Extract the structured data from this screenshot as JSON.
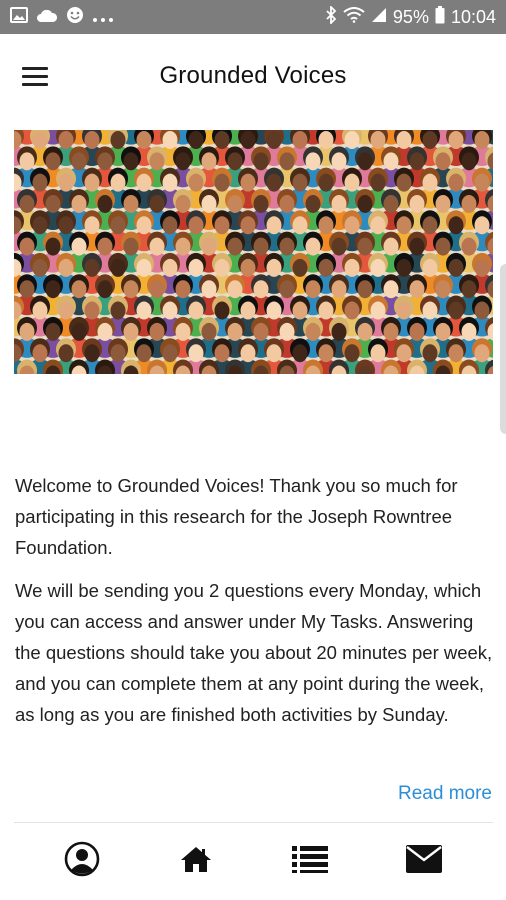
{
  "status_bar": {
    "battery": "95%",
    "time": "10:04",
    "icons_left": [
      "image-icon",
      "cloud-icon",
      "emoji-icon",
      "more-dots-icon"
    ],
    "icons_right": [
      "bluetooth-icon",
      "wifi-icon",
      "signal-icon",
      "battery-icon"
    ]
  },
  "header": {
    "title": "Grounded Voices",
    "menu_icon": "hamburger-menu-icon"
  },
  "banner": {
    "image": "crowd-of-diverse-people-illustration"
  },
  "content": {
    "paragraphs": [
      "Welcome to Grounded Voices! Thank you so much for participating in this research for the Joseph Rowntree Foundation.",
      "We will be sending you 2 questions every Monday, which you can access and answer under My Tasks. Answering the questions should take you about 20 minutes per week, and you can complete them at any point during the week, as long as you are finished both activities by Sunday."
    ],
    "read_more": "Read more"
  },
  "bottom_nav": {
    "items": [
      {
        "name": "profile",
        "icon": "user-circle-icon"
      },
      {
        "name": "home",
        "icon": "home-icon"
      },
      {
        "name": "tasks",
        "icon": "list-icon"
      },
      {
        "name": "messages",
        "icon": "envelope-icon"
      }
    ]
  },
  "colors": {
    "status_bar": "#7d7d7d",
    "link": "#2a8fd4",
    "text": "#222222"
  }
}
